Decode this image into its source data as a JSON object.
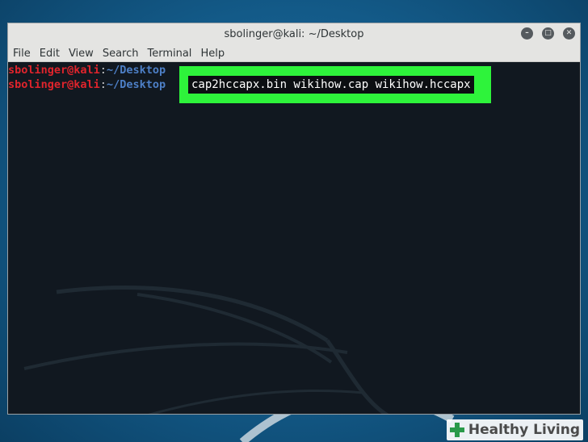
{
  "window": {
    "title": "sbolinger@kali: ~/Desktop",
    "buttons": [
      "minimize",
      "maximize",
      "close"
    ]
  },
  "menubar": {
    "items": [
      "File",
      "Edit",
      "View",
      "Search",
      "Terminal",
      "Help"
    ]
  },
  "terminal": {
    "lines": [
      {
        "user": "sbolinger@kali",
        "sep": ":",
        "path": "~/Desktop"
      },
      {
        "user": "sbolinger@kali",
        "sep": ":",
        "path": "~/Desktop"
      }
    ],
    "command": "cap2hccapx.bin wikihow.cap wikihow.hccapx"
  },
  "watermark": {
    "text": "Healthy Living",
    "color": "#2a9a4a"
  },
  "colors": {
    "highlight": "#2ef33b",
    "terminal_bg": "#111820",
    "user": "#e0242c",
    "path": "#4d7fc6"
  }
}
